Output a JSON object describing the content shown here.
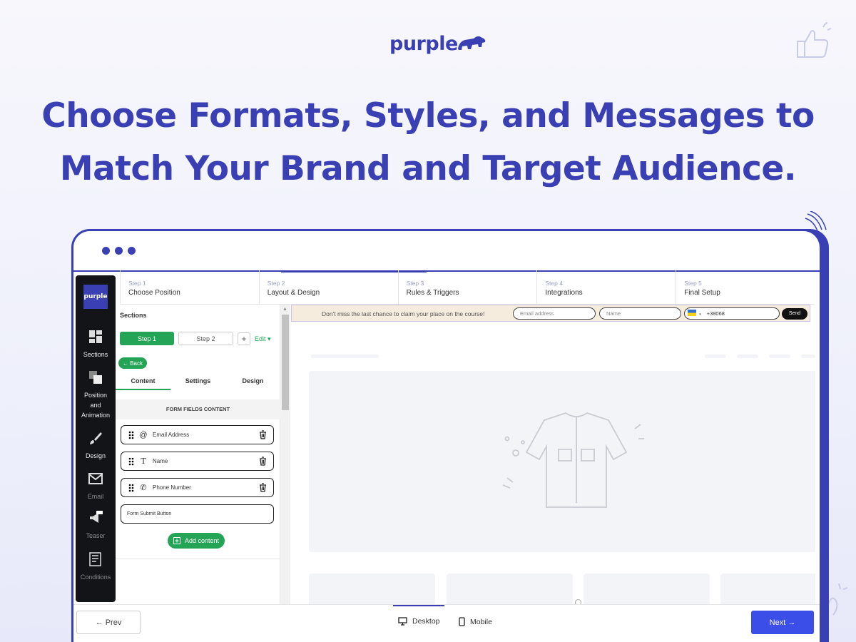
{
  "brand": {
    "logo_text": "purple",
    "bear_icon": "bear-icon",
    "accent": "#3a40b4",
    "green": "#23a456",
    "next_blue": "#3b4ee8"
  },
  "headline": {
    "line1": "Choose Formats, Styles, and Messages to",
    "line2": "Match Your Brand and Target Audience."
  },
  "sidebar": {
    "logo_text": "purple",
    "items": [
      {
        "label": "Sections",
        "icon": "sections-icon"
      },
      {
        "label": "Position and Animation",
        "icon": "position-icon"
      },
      {
        "label": "Design",
        "icon": "brush-icon"
      },
      {
        "label": "Email",
        "icon": "email-icon"
      },
      {
        "label": "Teaser",
        "icon": "megaphone-icon",
        "badge": "Teaser"
      },
      {
        "label": "Conditions",
        "icon": "conditions-icon"
      }
    ]
  },
  "steps": [
    {
      "num": "Step 1",
      "title": "Choose Position"
    },
    {
      "num": "Step 2",
      "title": "Layout & Design"
    },
    {
      "num": "Step 3",
      "title": "Rules & Triggers"
    },
    {
      "num": "Step 4",
      "title": "Integrations"
    },
    {
      "num": "Step 5",
      "title": "Final Setup"
    }
  ],
  "panel": {
    "title": "Sections",
    "step1": "Step 1",
    "step2": "Step 2",
    "plus": "+",
    "edit": "Edit ▾",
    "back": "← Back",
    "tabs": [
      "Content",
      "Settings",
      "Design"
    ],
    "section_heading": "FORM FIELDS CONTENT",
    "fields": [
      {
        "label": "Email Address",
        "icon": "@"
      },
      {
        "label": "Name",
        "icon": "T"
      },
      {
        "label": "Phone Number",
        "icon": "✆"
      }
    ],
    "submit_label": "Form Submit Button",
    "add_content": "Add content"
  },
  "preview": {
    "banner_message": "Don't miss the last chance to claim your place on the course!",
    "email_placeholder": "Email address",
    "name_placeholder": "Name",
    "phone_value": "+38068",
    "send_label": "Send"
  },
  "bottom": {
    "prev": "← Prev",
    "desktop": "Desktop",
    "mobile": "Mobile",
    "next": "Next →"
  }
}
